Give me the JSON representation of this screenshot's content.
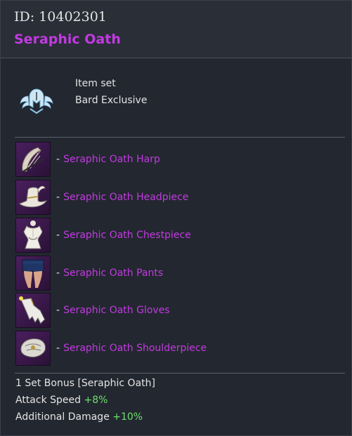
{
  "header": {
    "id_text": "ID: 10402301",
    "name": "Seraphic Oath"
  },
  "set_info": {
    "icon": "winged-helmet-icon",
    "type": "Item set",
    "class": "Bard Exclusive"
  },
  "pieces": [
    {
      "dash": "-",
      "name": "Seraphic Oath Harp",
      "icon": "harp-icon"
    },
    {
      "dash": "-",
      "name": "Seraphic Oath Headpiece",
      "icon": "hat-icon"
    },
    {
      "dash": "-",
      "name": "Seraphic Oath Chestpiece",
      "icon": "chestpiece-icon"
    },
    {
      "dash": "-",
      "name": "Seraphic Oath Pants",
      "icon": "pants-icon"
    },
    {
      "dash": "-",
      "name": "Seraphic Oath Gloves",
      "icon": "gloves-icon"
    },
    {
      "dash": "-",
      "name": "Seraphic Oath Shoulderpiece",
      "icon": "shoulderpiece-icon"
    }
  ],
  "bonus": {
    "title": "1 Set Bonus [Seraphic Oath]",
    "stats": [
      {
        "label": "Attack Speed",
        "value": "+8%"
      },
      {
        "label": "Additional Damage",
        "value": "+10%"
      }
    ]
  },
  "colors": {
    "background": "#232730",
    "item_name": "#c13be0",
    "bonus_value": "#6fe06f"
  }
}
